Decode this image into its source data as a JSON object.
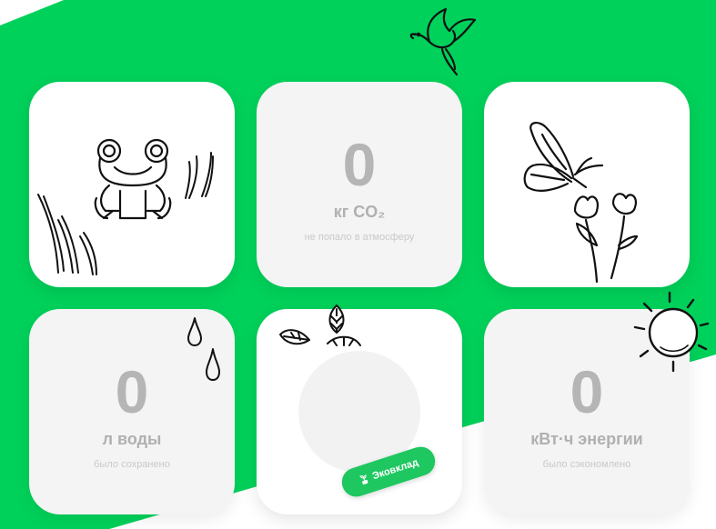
{
  "colors": {
    "green": "#00d15a",
    "pill_green": "#1ec760",
    "stat_grey": "#b5b5b5"
  },
  "cards": {
    "co2": {
      "value": "0",
      "unit": "кг CO₂",
      "caption": "не попало в атмосферу"
    },
    "water": {
      "value": "0",
      "unit": "л воды",
      "caption": "было сохранено"
    },
    "energy": {
      "value": "0",
      "unit": "кВт·ч энергии",
      "caption": "было сэкономлено"
    }
  },
  "badge": {
    "label": "Эковклад",
    "icon": "sprout-icon"
  },
  "icons": [
    "bird-icon",
    "frog-icon",
    "butterfly-icon",
    "flower-icon",
    "raindrop-icon",
    "leaf-icon",
    "sun-icon"
  ]
}
